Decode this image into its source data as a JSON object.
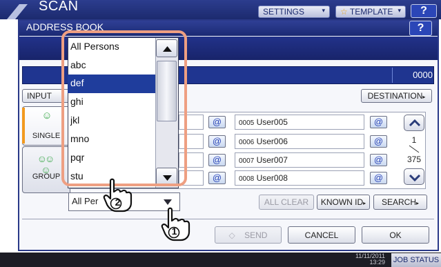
{
  "background_screen": {
    "title": "SCAN",
    "settings_label": "SETTINGS",
    "template_label": "TEMPLATE",
    "help_label": "?",
    "datetime": "11/11/2011",
    "time": "13:29",
    "job_status_label": "JOB STATUS"
  },
  "dialog": {
    "title": "ADDRESS BOOK",
    "help_label": "?",
    "count_value": "0000",
    "input_label": "INPUT",
    "destination_label": "DESTINATION"
  },
  "tabs": {
    "single_label": "SINGLE",
    "group_label": "GROUP"
  },
  "address_rows": [
    {
      "id": "0005",
      "name": "User005",
      "at": "@"
    },
    {
      "id": "0006",
      "name": "User006",
      "at": "@"
    },
    {
      "id": "0007",
      "name": "User007",
      "at": "@"
    },
    {
      "id": "0008",
      "name": "User008",
      "at": "@"
    }
  ],
  "paging": {
    "current": "1",
    "total": "375"
  },
  "group_select": {
    "value": "All Persons",
    "visible_text": "All Per"
  },
  "dropdown": {
    "items": [
      "All Persons",
      "abc",
      "def",
      "ghi",
      "jkl",
      "mno",
      "pqr",
      "stu"
    ],
    "selected_index": 2
  },
  "actions": {
    "all_clear_label": "ALL CLEAR",
    "known_id_label": "KNOWN ID",
    "search_label": "SEARCH",
    "send_label": "SEND",
    "cancel_label": "CANCEL",
    "ok_label": "OK"
  },
  "callouts": {
    "step_1": "1",
    "step_2": "2"
  },
  "colors": {
    "header_blue": "#1c2a6e",
    "selection_blue": "#1f3d9c",
    "highlight_frame": "#ee9f82",
    "tab_accent": "#f29a1e",
    "user_icon_green": "#3aa84a"
  }
}
